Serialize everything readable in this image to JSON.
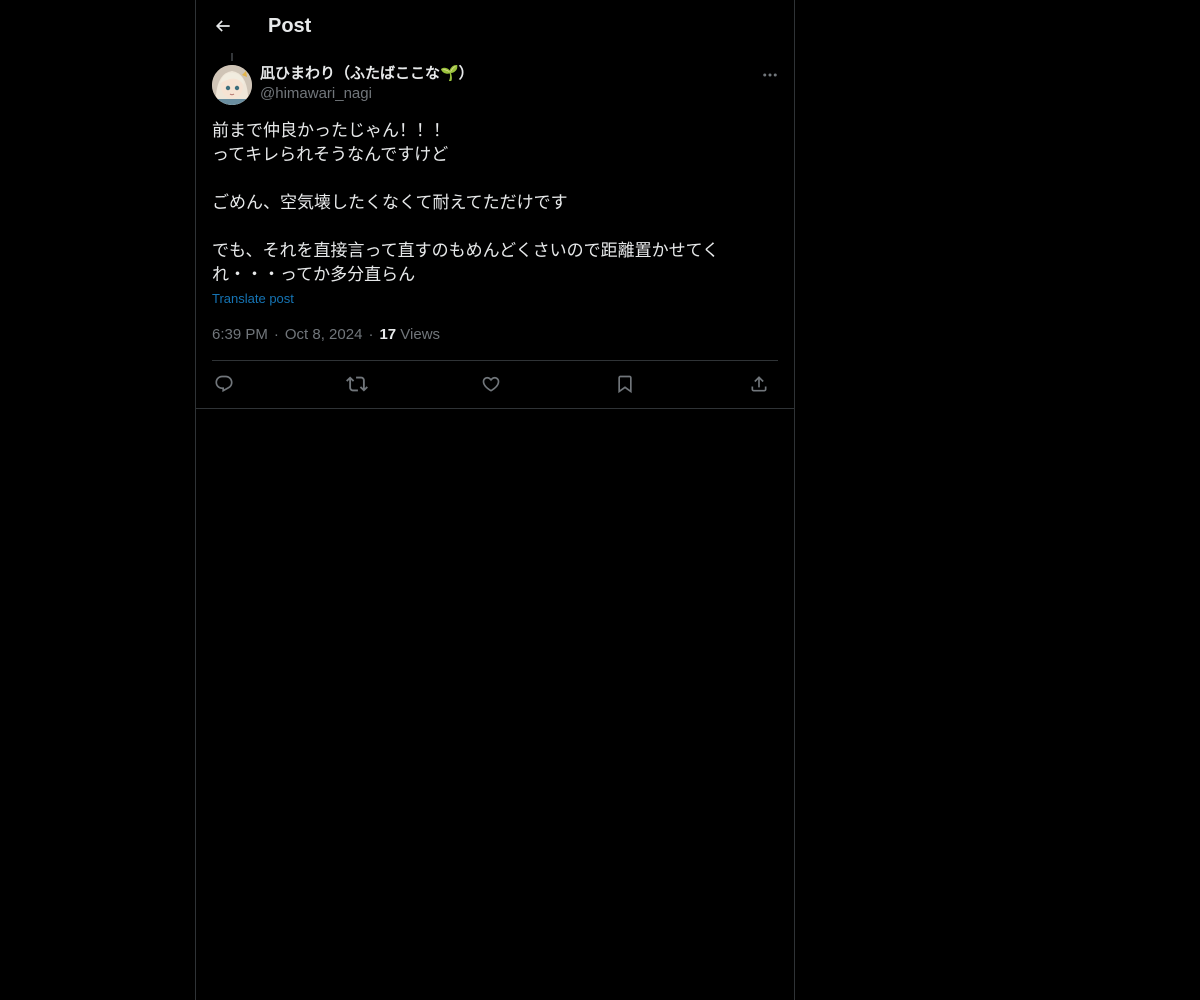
{
  "header": {
    "back_icon": "arrow-left-icon",
    "title": "Post"
  },
  "post": {
    "author": {
      "display_name": "凪ひまわり（ふたばここな🌱）",
      "handle": "@himawari_nagi"
    },
    "text": "前まで仲良かったじゃん！！！\nってキレられそうなんですけど\n\nごめん、空気壊したくなくて耐えてただけです\n\nでも、それを直接言って直すのもめんどくさいので距離置かせてく\nれ・・・ってか多分直らん",
    "translate_label": "Translate post",
    "time": "6:39 PM",
    "date": "Oct 8, 2024",
    "views_count": "17",
    "views_label": "Views"
  },
  "actions": [
    {
      "name": "reply",
      "icon": "reply-icon"
    },
    {
      "name": "repost",
      "icon": "repost-icon"
    },
    {
      "name": "like",
      "icon": "heart-icon"
    },
    {
      "name": "bookmark",
      "icon": "bookmark-icon"
    },
    {
      "name": "share",
      "icon": "share-icon"
    }
  ],
  "colors": {
    "background": "#000000",
    "text": "#e7e9ea",
    "secondary": "#71767b",
    "link": "#1d9bf0",
    "border": "#2f3336"
  }
}
